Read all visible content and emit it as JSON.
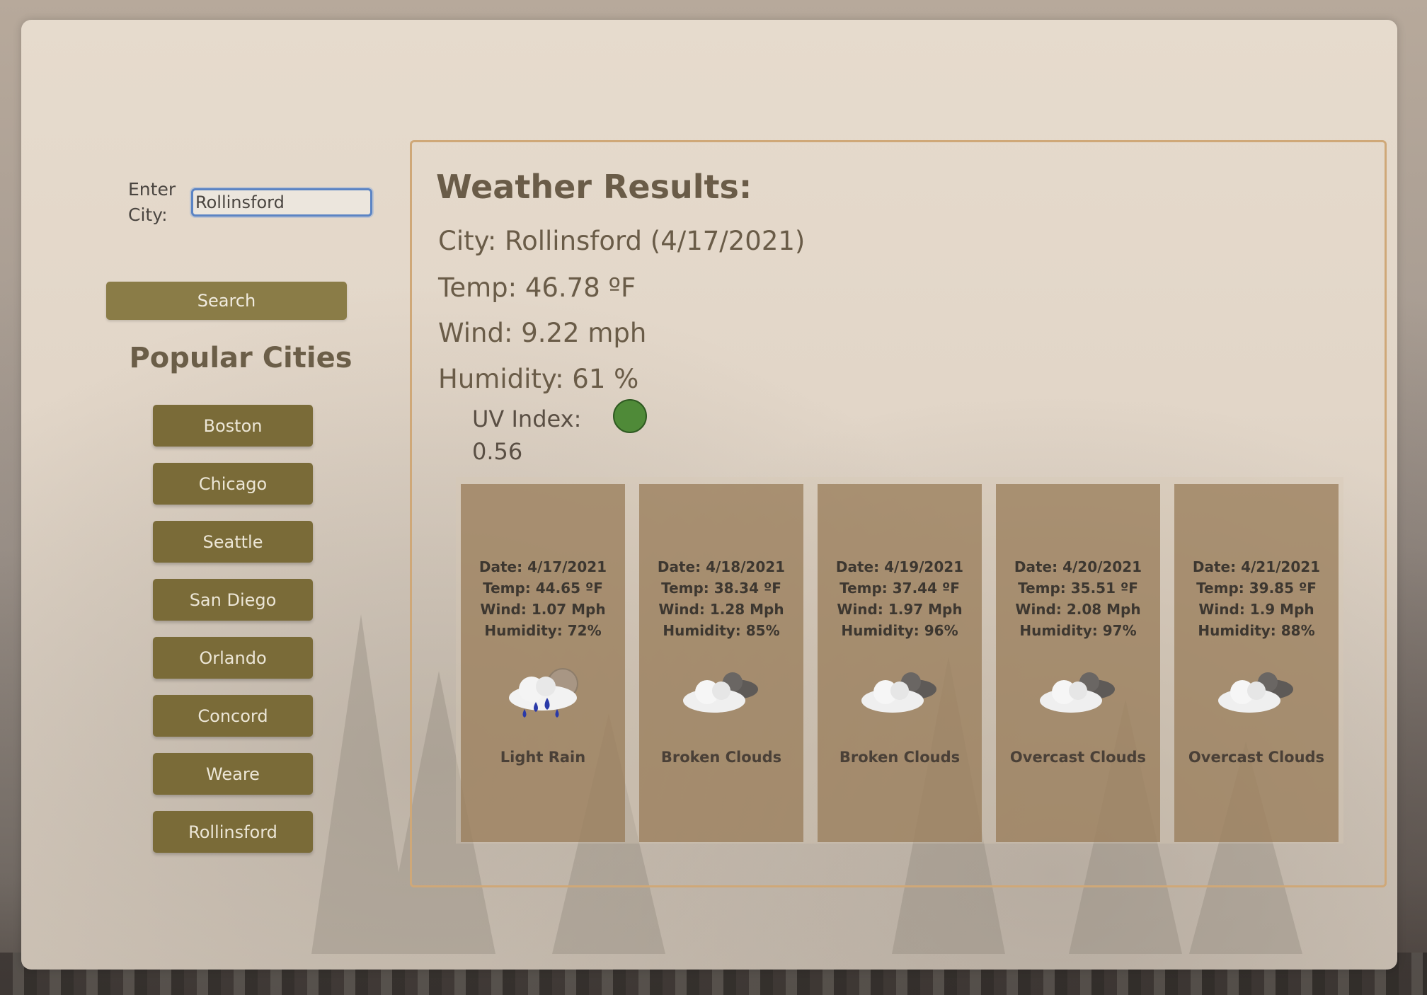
{
  "search": {
    "label": "Enter City:",
    "value": "Rollinsford",
    "button_label": "Search"
  },
  "popular": {
    "title": "Popular Cities",
    "cities": [
      "Boston",
      "Chicago",
      "Seattle",
      "San Diego",
      "Orlando",
      "Concord",
      "Weare",
      "Rollinsford"
    ]
  },
  "results": {
    "title": "Weather Results:",
    "city_line": "City: Rollinsford (4/17/2021)",
    "temp_line": "Temp: 46.78 ºF",
    "wind_line": "Wind: 9.22 mph",
    "humidity_line": "Humidity: 61 %",
    "uv_label": "UV Index:",
    "uv_value": "0.56",
    "uv_color": "#4f8a38"
  },
  "forecast": [
    {
      "date": "Date: 4/17/2021",
      "temp": "Temp: 44.65 ºF",
      "wind": "Wind: 1.07 Mph",
      "humidity": "Humidity: 72%",
      "icon": "rain-cloud-icon",
      "description": "Light Rain"
    },
    {
      "date": "Date: 4/18/2021",
      "temp": "Temp: 38.34 ºF",
      "wind": "Wind: 1.28 Mph",
      "humidity": "Humidity: 85%",
      "icon": "broken-clouds-icon",
      "description": "Broken Clouds"
    },
    {
      "date": "Date: 4/19/2021",
      "temp": "Temp: 37.44 ºF",
      "wind": "Wind: 1.97 Mph",
      "humidity": "Humidity: 96%",
      "icon": "broken-clouds-icon",
      "description": "Broken Clouds"
    },
    {
      "date": "Date: 4/20/2021",
      "temp": "Temp: 35.51 ºF",
      "wind": "Wind: 2.08 Mph",
      "humidity": "Humidity: 97%",
      "icon": "overcast-clouds-icon",
      "description": "Overcast Clouds"
    },
    {
      "date": "Date: 4/21/2021",
      "temp": "Temp: 39.85 ºF",
      "wind": "Wind: 1.9 Mph",
      "humidity": "Humidity: 88%",
      "icon": "overcast-clouds-icon",
      "description": "Overcast Clouds"
    }
  ]
}
